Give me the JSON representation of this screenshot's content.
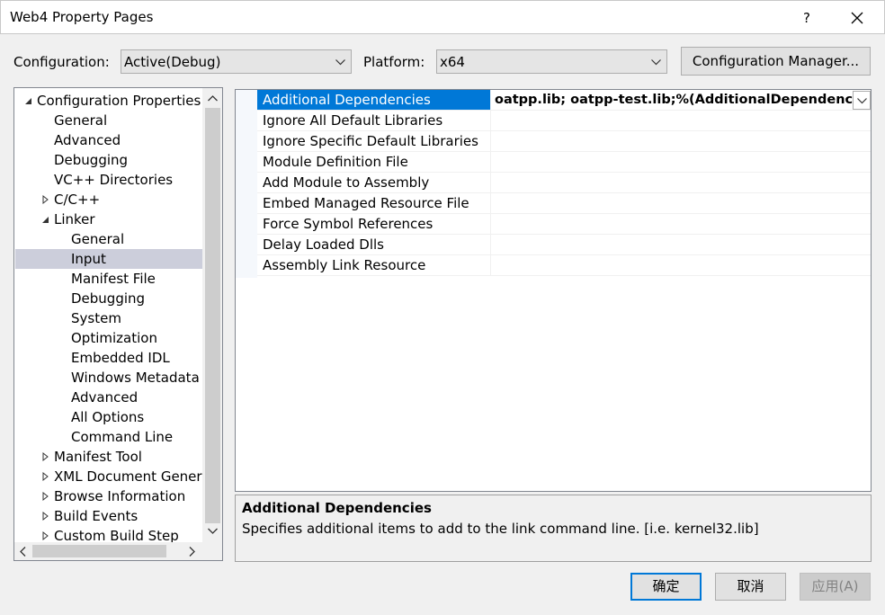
{
  "window": {
    "title": "Web4 Property Pages",
    "help_label": "?"
  },
  "config": {
    "configuration_label": "Configuration:",
    "configuration_value": "Active(Debug)",
    "platform_label": "Platform:",
    "platform_value": "x64",
    "manager_button": "Configuration Manager..."
  },
  "tree": {
    "items": [
      {
        "label": "Configuration Properties",
        "expander": "expanded"
      },
      {
        "label": "General"
      },
      {
        "label": "Advanced"
      },
      {
        "label": "Debugging"
      },
      {
        "label": "VC++ Directories"
      },
      {
        "label": "C/C++",
        "expander": "collapsed"
      },
      {
        "label": "Linker",
        "expander": "expanded"
      },
      {
        "label": "General"
      },
      {
        "label": "Input",
        "selected": true
      },
      {
        "label": "Manifest File"
      },
      {
        "label": "Debugging"
      },
      {
        "label": "System"
      },
      {
        "label": "Optimization"
      },
      {
        "label": "Embedded IDL"
      },
      {
        "label": "Windows Metadata"
      },
      {
        "label": "Advanced"
      },
      {
        "label": "All Options"
      },
      {
        "label": "Command Line"
      },
      {
        "label": "Manifest Tool",
        "expander": "collapsed"
      },
      {
        "label": "XML Document Genera",
        "expander": "collapsed"
      },
      {
        "label": "Browse Information",
        "expander": "collapsed"
      },
      {
        "label": "Build Events",
        "expander": "collapsed"
      },
      {
        "label": "Custom Build Step",
        "expander": "collapsed"
      }
    ]
  },
  "properties": {
    "rows": [
      {
        "name": "Additional Dependencies",
        "value": "oatpp.lib;  oatpp-test.lib;%(AdditionalDependencies)",
        "selected": true
      },
      {
        "name": "Ignore All Default Libraries",
        "value": ""
      },
      {
        "name": "Ignore Specific Default Libraries",
        "value": ""
      },
      {
        "name": "Module Definition File",
        "value": ""
      },
      {
        "name": "Add Module to Assembly",
        "value": ""
      },
      {
        "name": "Embed Managed Resource File",
        "value": ""
      },
      {
        "name": "Force Symbol References",
        "value": ""
      },
      {
        "name": "Delay Loaded Dlls",
        "value": ""
      },
      {
        "name": "Assembly Link Resource",
        "value": ""
      }
    ]
  },
  "description": {
    "title": "Additional Dependencies",
    "text": "Specifies additional items to add to the link command line. [i.e. kernel32.lib]"
  },
  "footer": {
    "ok": "确定",
    "cancel": "取消",
    "apply": "应用(A)"
  },
  "colors": {
    "selection": "#0078d7",
    "tree_selection": "#cccedb",
    "disabled_text": "#838383"
  }
}
